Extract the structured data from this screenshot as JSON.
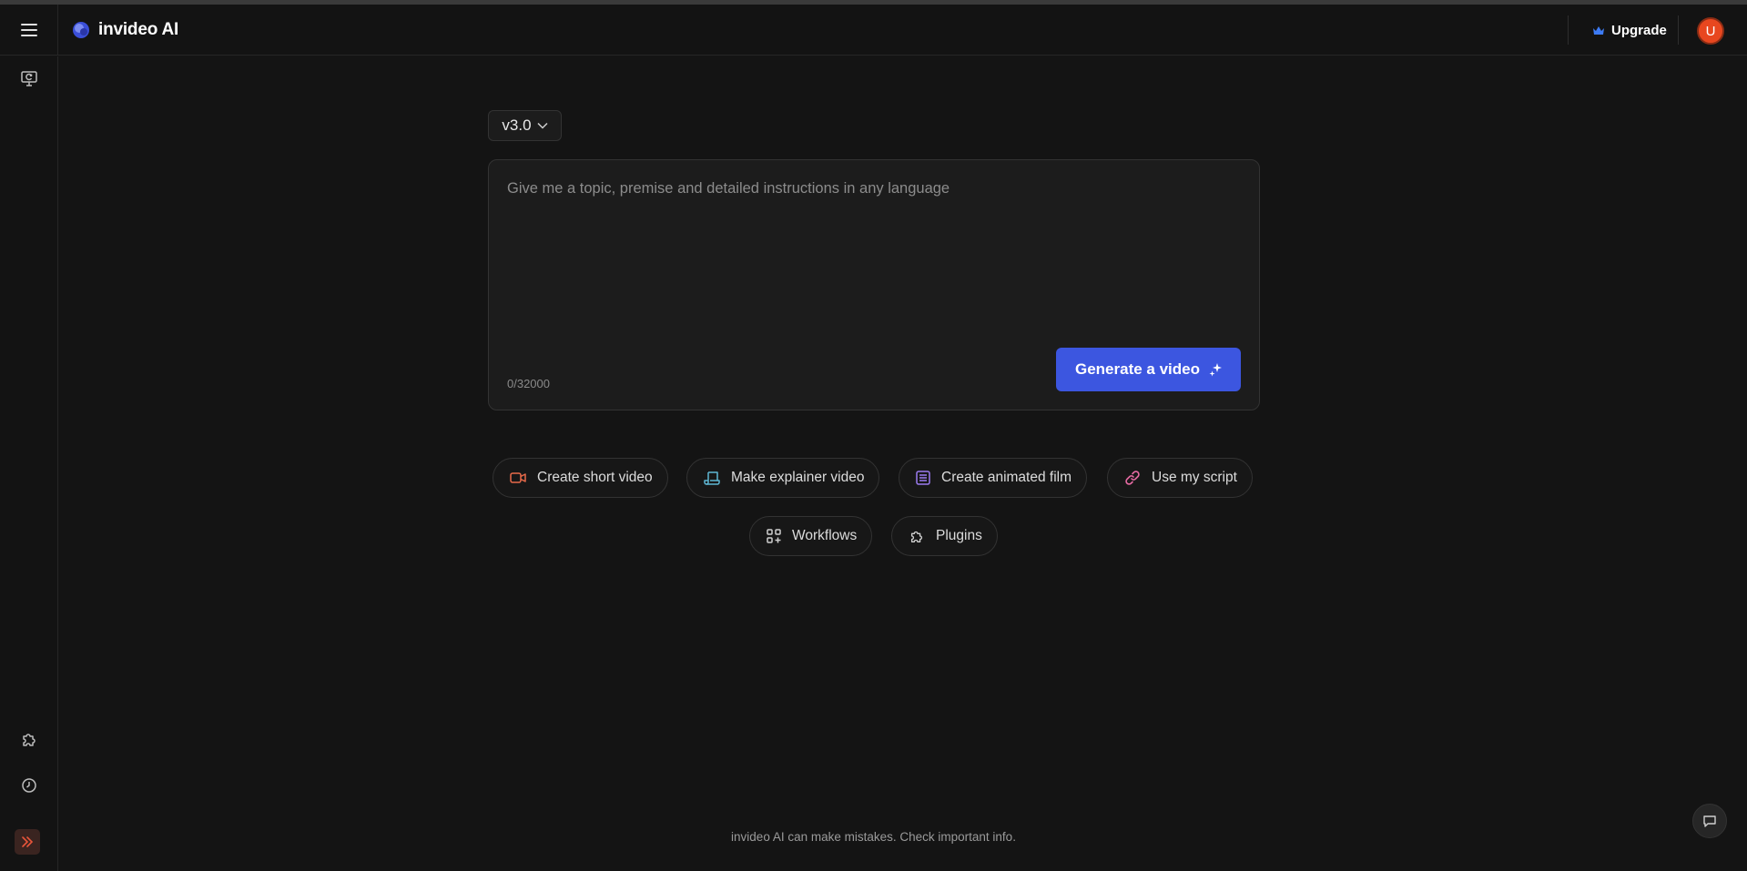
{
  "header": {
    "brand_name": "invideo AI",
    "upgrade_label": "Upgrade",
    "avatar_initial": "U"
  },
  "sidebar": {
    "icons": [
      "monitor-refresh-icon",
      "puzzle-icon",
      "history-icon",
      "expand-chevrons-icon"
    ]
  },
  "main": {
    "version_label": "v3.0",
    "prompt": {
      "placeholder": "Give me a topic, premise and detailed instructions in any language",
      "value": "",
      "char_count": "0/32000"
    },
    "generate_label": "Generate a video",
    "chips": [
      {
        "label": "Create short video",
        "icon": "video-camera-icon"
      },
      {
        "label": "Make explainer video",
        "icon": "scroll-icon"
      },
      {
        "label": "Create animated film",
        "icon": "document-lines-icon"
      },
      {
        "label": "Use my script",
        "icon": "link-icon"
      },
      {
        "label": "Workflows",
        "icon": "grid-plus-icon"
      },
      {
        "label": "Plugins",
        "icon": "puzzle-icon"
      }
    ]
  },
  "footer": {
    "disclaimer": "invideo AI can make mistakes. Check important info."
  },
  "colors": {
    "background": "#141414",
    "accent_button": "#3c56e0",
    "avatar": "#e8471f",
    "crown": "#3d7bf5"
  }
}
